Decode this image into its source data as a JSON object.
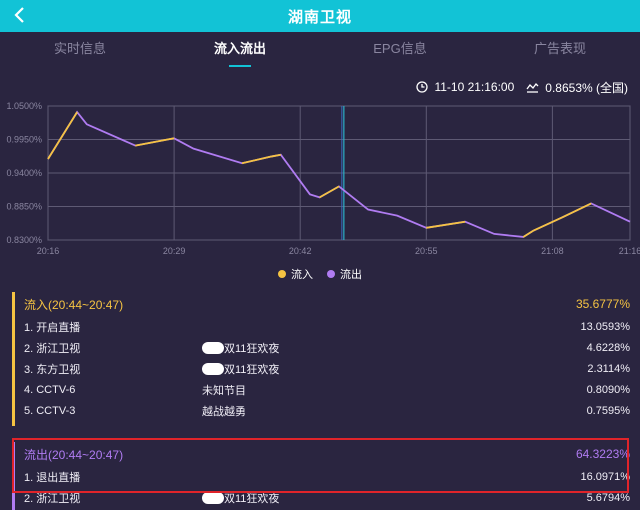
{
  "header": {
    "back_icon": "chevron-left-icon",
    "title": "湖南卫视"
  },
  "tabs": [
    {
      "label": "实时信息",
      "active": false
    },
    {
      "label": "流入流出",
      "active": true
    },
    {
      "label": "EPG信息",
      "active": false
    },
    {
      "label": "广告表现",
      "active": false
    }
  ],
  "info": {
    "time_icon": "clock-icon",
    "time": "11-10 21:16:00",
    "rating_icon": "trend-icon",
    "rating": "0.8653% (全国)"
  },
  "colors": {
    "accent": "#12c3d6",
    "inflow": "#f5c342",
    "outflow": "#b07cf2",
    "highlight": "#e0242a"
  },
  "chart_data": {
    "type": "line",
    "y_ticks": [
      "1.0500%",
      "0.9950%",
      "0.9400%",
      "0.8850%",
      "0.8300%"
    ],
    "ylim": [
      0.83,
      1.05
    ],
    "x_ticks": [
      "20:16",
      "20:29",
      "20:42",
      "20:55",
      "21:08",
      "21:16"
    ],
    "x_tick_minutes": [
      0,
      13,
      26,
      39,
      52,
      60
    ],
    "cursor_minute": 30.5,
    "series": [
      {
        "name": "流入",
        "color": "#f5c342",
        "x": [
          0,
          3,
          4,
          9,
          13,
          15,
          20,
          23,
          24,
          27,
          28,
          30,
          33,
          36,
          39,
          43,
          46,
          49,
          50,
          53,
          56
        ],
        "y": [
          0.963,
          1.04,
          1.02,
          0.985,
          0.997,
          0.98,
          0.956,
          0.967,
          0.97,
          0.905,
          0.9,
          0.918,
          0.88,
          0.87,
          0.85,
          0.86,
          0.84,
          0.835,
          0.845,
          0.867,
          0.89
        ]
      },
      {
        "name": "流出",
        "color": "#b07cf2",
        "x": [
          0,
          3,
          4,
          9,
          13,
          15,
          20,
          23,
          24,
          27,
          28,
          30,
          33,
          36,
          39,
          43,
          46,
          49,
          50,
          53,
          56,
          60
        ],
        "y": [
          0.963,
          1.04,
          1.02,
          0.985,
          0.997,
          0.98,
          0.956,
          0.967,
          0.97,
          0.905,
          0.9,
          0.918,
          0.88,
          0.87,
          0.85,
          0.86,
          0.84,
          0.835,
          0.845,
          0.867,
          0.89,
          0.86
        ]
      }
    ],
    "legend": [
      "流入",
      "流出"
    ]
  },
  "inflow": {
    "title": "流入(20:44~20:47)",
    "total": "35.6777%",
    "rows": [
      {
        "name": "1. 开启直播",
        "program": "",
        "pct": "13.0593%"
      },
      {
        "name": "2. 浙江卫视",
        "program": "双11狂欢夜",
        "pct": "4.6228%"
      },
      {
        "name": "3. 东方卫视",
        "program": "双11狂欢夜",
        "pct": "2.3114%"
      },
      {
        "name": "4. CCTV-6",
        "program": "未知节目",
        "pct": "0.8090%"
      },
      {
        "name": "5. CCTV-3",
        "program": "越战越勇",
        "pct": "0.7595%"
      }
    ]
  },
  "outflow": {
    "title": "流出(20:44~20:47)",
    "total": "64.3223%",
    "rows": [
      {
        "name": "1. 退出直播",
        "program": "",
        "pct": "16.0971%"
      },
      {
        "name": "2. 浙江卫视",
        "program": "双11狂欢夜",
        "pct": "5.6794%"
      }
    ]
  }
}
